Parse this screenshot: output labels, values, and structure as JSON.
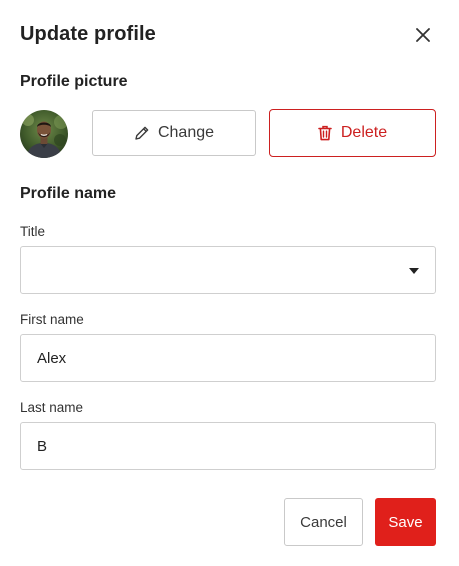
{
  "dialog": {
    "title": "Update profile",
    "close_icon": "close-icon"
  },
  "profile_picture": {
    "heading": "Profile picture",
    "change_label": "Change",
    "change_icon": "pencil-icon",
    "delete_label": "Delete",
    "delete_icon": "trash-icon",
    "colors": {
      "delete": "#cc2020"
    }
  },
  "profile_name": {
    "heading": "Profile name",
    "title_field": {
      "label": "Title",
      "value": ""
    },
    "first_name": {
      "label": "First name",
      "value": "Alex"
    },
    "last_name": {
      "label": "Last name",
      "value": "B"
    }
  },
  "actions": {
    "cancel_label": "Cancel",
    "save_label": "Save",
    "colors": {
      "save": "#e0201b"
    }
  }
}
